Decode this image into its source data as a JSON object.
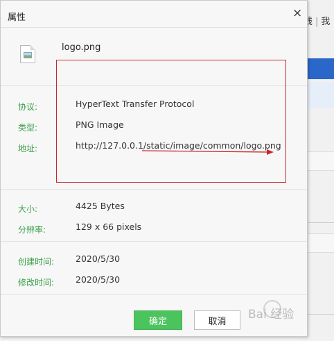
{
  "background": {
    "nav_text_1": "线",
    "nav_text_2": "我",
    "nav_sep": "|"
  },
  "dialog": {
    "title": "属性",
    "close_glyph": "×",
    "file_name": "logo.png",
    "properties": [
      {
        "label": "协议:",
        "value": "HyperText Transfer Protocol"
      },
      {
        "label": "类型:",
        "value": "PNG Image"
      },
      {
        "label": "地址:",
        "value": "http://127.0.0.1/static/image/common/logo.png"
      },
      {
        "label": "大小:",
        "value": "4425 Bytes"
      },
      {
        "label": "分辨率:",
        "value": "129 x 66 pixels"
      },
      {
        "label": "创建时间:",
        "value": "2020/5/30"
      },
      {
        "label": "修改时间:",
        "value": "2020/5/30"
      }
    ],
    "buttons": {
      "ok": "确定",
      "cancel": "取消"
    }
  },
  "annotation": {
    "box_color": "#c8272a"
  },
  "watermark": {
    "text": "Bai 经验"
  },
  "colors": {
    "label": "#3aa04a",
    "ok_button": "#4cc45e",
    "nav_blue": "#2b66c9"
  }
}
